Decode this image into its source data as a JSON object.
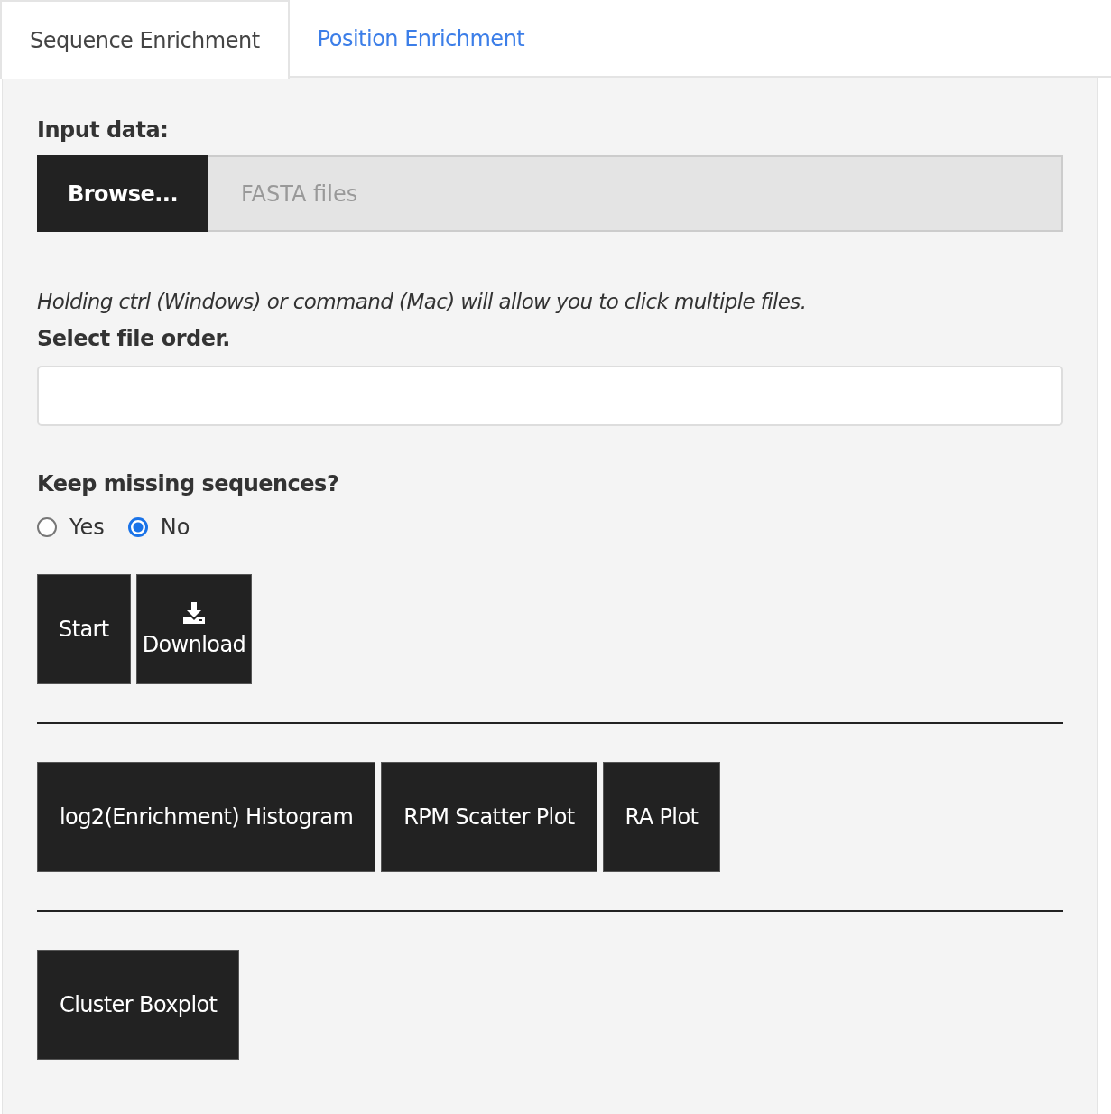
{
  "tabs": [
    {
      "label": "Sequence Enrichment",
      "selected": true
    },
    {
      "label": "Position Enrichment",
      "selected": false
    }
  ],
  "input_data": {
    "label": "Input data:",
    "button": "Browse...",
    "placeholder": "FASTA files"
  },
  "hint": "Holding ctrl (Windows) or command (Mac) will allow you to click multiple files.",
  "file_order": {
    "label": "Select file order."
  },
  "keep_missing": {
    "label": "Keep missing sequences?",
    "options": [
      {
        "label": "Yes",
        "selected": false
      },
      {
        "label": "No",
        "selected": true
      }
    ]
  },
  "action_buttons": [
    {
      "label": "Start",
      "kind": "plain"
    },
    {
      "label": "Download",
      "kind": "download"
    }
  ],
  "plot_buttons": [
    {
      "label": "log2(Enrichment) Histogram"
    },
    {
      "label": "RPM Scatter Plot"
    },
    {
      "label": "RA Plot"
    }
  ],
  "cluster_buttons": [
    {
      "label": "Cluster Boxplot"
    }
  ]
}
